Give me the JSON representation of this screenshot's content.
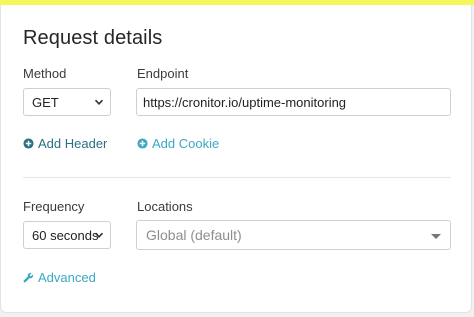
{
  "colors": {
    "top_bar": "#f5f65a",
    "link_dark": "#2a6f86",
    "link_light": "#3aa9c4",
    "placeholder_text": "#8e8e8e"
  },
  "panel": {
    "title": "Request details"
  },
  "request": {
    "method_label": "Method",
    "method_value": "GET",
    "endpoint_label": "Endpoint",
    "endpoint_value": "https://cronitor.io/uptime-monitoring",
    "add_header": "Add Header",
    "add_cookie": "Add Cookie",
    "add_header_icon": "plus-circle-icon",
    "add_cookie_icon": "plus-circle-icon"
  },
  "schedule": {
    "frequency_label": "Frequency",
    "frequency_value": "60 seconds",
    "locations_label": "Locations",
    "locations_value": "Global (default)",
    "advanced": "Advanced",
    "advanced_icon": "wrench-icon"
  }
}
